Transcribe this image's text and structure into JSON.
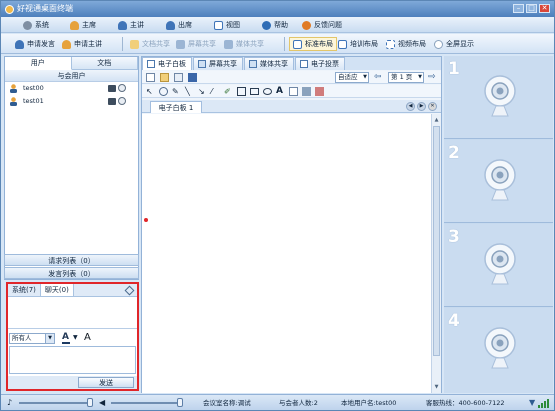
{
  "window": {
    "title": "好视通桌面终端",
    "min": "–",
    "max": "□",
    "close": "✕"
  },
  "menu": [
    {
      "label": "系统",
      "icon": "gear-icon"
    },
    {
      "label": "主席",
      "icon": "user-icon"
    },
    {
      "label": "主讲",
      "icon": "user-icon"
    },
    {
      "label": "出席",
      "icon": "user-icon"
    },
    {
      "label": "视图",
      "icon": "view-icon"
    },
    {
      "label": "帮助",
      "icon": "help-icon"
    },
    {
      "label": "反馈问题",
      "icon": "feedback-icon"
    }
  ],
  "toolbar": {
    "apply_speak": "申请发言",
    "apply_lecture": "申请主讲",
    "doc_share": "文档共享",
    "screen_share": "屏幕共享",
    "media_share": "媒体共享",
    "standard_layout": "标准布局",
    "training_layout": "培训布局",
    "video_layout": "视频布局",
    "fullscreen": "全屏显示"
  },
  "left": {
    "tabs": [
      "用户",
      "文档"
    ],
    "header": "与会用户",
    "users": [
      "test00",
      "test01"
    ],
    "request_list": "请求列表（0）",
    "speak_list": "发言列表（0）"
  },
  "chat": {
    "tabs": [
      "系统(7)",
      "聊天(0)"
    ],
    "recipient": "所有人",
    "font_a": "A",
    "font_b": "A",
    "send": "发送"
  },
  "center": {
    "tabs": [
      "电子白板",
      "屏幕共享",
      "媒体共享",
      "电子投票"
    ],
    "zoom": "自适应",
    "page": "第 1 页",
    "doc_tab": "电子白板 1"
  },
  "video": {
    "slots": [
      "1",
      "2",
      "3",
      "4"
    ]
  },
  "status": {
    "room": "会议室名称:调试",
    "attendees": "与会者人数:2",
    "local_user": "本地用户名:test00",
    "hotline": "客服热线：400-600-7122"
  },
  "colors": {
    "accent": "#4d7fbc",
    "highlight_border": "#e0262a",
    "panel": "#d7e6f6"
  }
}
